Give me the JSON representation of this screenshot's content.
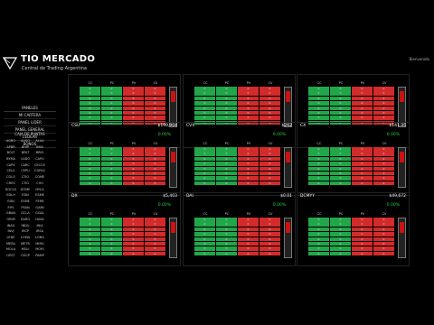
{
  "brand": {
    "title": "TIO MERCADO",
    "tagline": "Central de Trading Argentina",
    "user": "Bienvenido"
  },
  "sidebar": {
    "header": "PANELES",
    "items": [
      "MI CARTERA",
      "PANEL LIDER",
      "PANEL GENERAL",
      "CEDEAR",
      "BONOS"
    ],
    "caja_title": "CAJA DE PUNTAS",
    "symbols": [
      [
        "AGRO",
        "AUSO",
        "ALUA"
      ],
      [
        "APBR",
        "BHIP",
        "BMA"
      ],
      [
        "BOLT",
        "BPAT",
        "BRIO"
      ],
      [
        "BYMA",
        "CADO",
        "CAPU"
      ],
      [
        "CAPX",
        "CARC",
        "CECO2"
      ],
      [
        "CELU",
        "CEPU",
        "CGPA2"
      ],
      [
        "COLO",
        "CTIO",
        "COME"
      ],
      [
        "CRES",
        "CTIO",
        "CVH"
      ],
      [
        "DGCU2",
        "DOME",
        "DYCA"
      ],
      [
        "EDLH",
        "EDN",
        "ESME"
      ],
      [
        "EDN",
        "ESME",
        "FERR"
      ],
      [
        "FIPL",
        "FRAN",
        "GAMI"
      ],
      [
        "GBAN",
        "GCLA",
        "GGAL"
      ],
      [
        "GRIM",
        "HARG",
        "HAVA"
      ],
      [
        "INAG",
        "INDU",
        "INVJ"
      ],
      [
        "INVJ",
        "IRCP",
        "IRSA"
      ],
      [
        "LEDE",
        "LOMA",
        "LONG"
      ],
      [
        "MERA",
        "METR",
        "MIRG"
      ],
      [
        "MOLA",
        "MOLI",
        "MORI"
      ],
      [
        "OEST",
        "OGCP",
        "PAMP"
      ]
    ]
  },
  "columns": [
    "CC",
    "PC",
    "PV",
    "CV"
  ],
  "panels": [
    {
      "symbol": "",
      "price": "",
      "change": "",
      "rows": 8
    },
    {
      "symbol": "",
      "price": "",
      "change": "",
      "rows": 8
    },
    {
      "symbol": "",
      "price": "",
      "change": "",
      "rows": 8
    },
    {
      "symbol": "CSU",
      "price": "$199,904",
      "change": "0.00%",
      "rows": 8
    },
    {
      "symbol": "CVX",
      "price": "$262",
      "change": "0.00%",
      "rows": 8
    },
    {
      "symbol": "CX",
      "price": "$141.35",
      "change": "0.00%",
      "rows": 8
    },
    {
      "symbol": "DX",
      "price": "$5,403",
      "change": "0.00%",
      "rows": 8
    },
    {
      "symbol": "DAI",
      "price": "$0.01",
      "change": "0.00%",
      "rows": 8
    },
    {
      "symbol": "DCMYY",
      "price": "$49,672",
      "change": "0.00%",
      "rows": 8
    }
  ],
  "cell_value": "0",
  "colors": {
    "buy": "#22a64a",
    "sell": "#d22b2b",
    "scroll": "#c11111"
  }
}
